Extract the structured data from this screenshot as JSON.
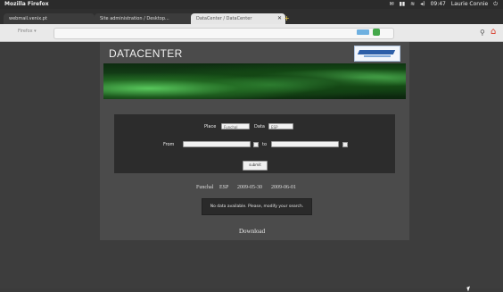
{
  "window": {
    "title": "Mozilla Firefox"
  },
  "tray": [
    "✉",
    "▮▮",
    "≋",
    "◂)",
    "09:47",
    "Laurie Connie",
    "⏻"
  ],
  "tabs": [
    {
      "label": "webmail.venix.pt"
    },
    {
      "label": "Site administration / Desktop..."
    },
    {
      "label": "DataCenter / DataCenter",
      "close": "✕"
    }
  ],
  "newtab": {
    "label": "+"
  },
  "nav": {
    "left_text": "Firefox ▾"
  },
  "page": {
    "brand": "DATACENTER",
    "form": {
      "place_label": "Place",
      "place_value": "Funchal",
      "data_label": "Data",
      "data_value": "ESP",
      "from_label": "From",
      "from_value": "",
      "to_label": "to",
      "to_value": "",
      "submit_label": "submit"
    },
    "summary": {
      "place": "Funchal",
      "data": "ESP",
      "from": "2009-05-30",
      "to": "2009-06-01"
    },
    "notice": "No data available. Please, modify your search.",
    "download": "Download"
  },
  "icons": {
    "search": "⚲",
    "home": "⌂"
  }
}
